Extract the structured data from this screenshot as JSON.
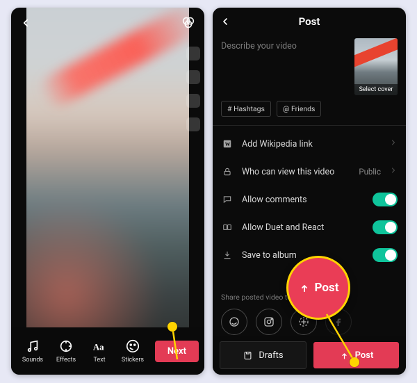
{
  "editor": {
    "tools": {
      "sounds": "Sounds",
      "effects": "Effects",
      "text": "Text",
      "stickers": "Stickers"
    },
    "next_label": "Next"
  },
  "post": {
    "header_title": "Post",
    "description_placeholder": "Describe your video",
    "chips": {
      "hashtags": "# Hashtags",
      "friends": "@ Friends"
    },
    "cover_label": "Select cover",
    "rows": {
      "wikipedia": "Add Wikipedia link",
      "privacy": "Who can view this video",
      "privacy_value": "Public",
      "comments": "Allow comments",
      "duet": "Allow Duet and React",
      "save": "Save to album"
    },
    "share_label": "Share posted video to:",
    "footer": {
      "drafts": "Drafts",
      "post": "Post"
    }
  },
  "annotation": {
    "callout_label": "Post"
  }
}
